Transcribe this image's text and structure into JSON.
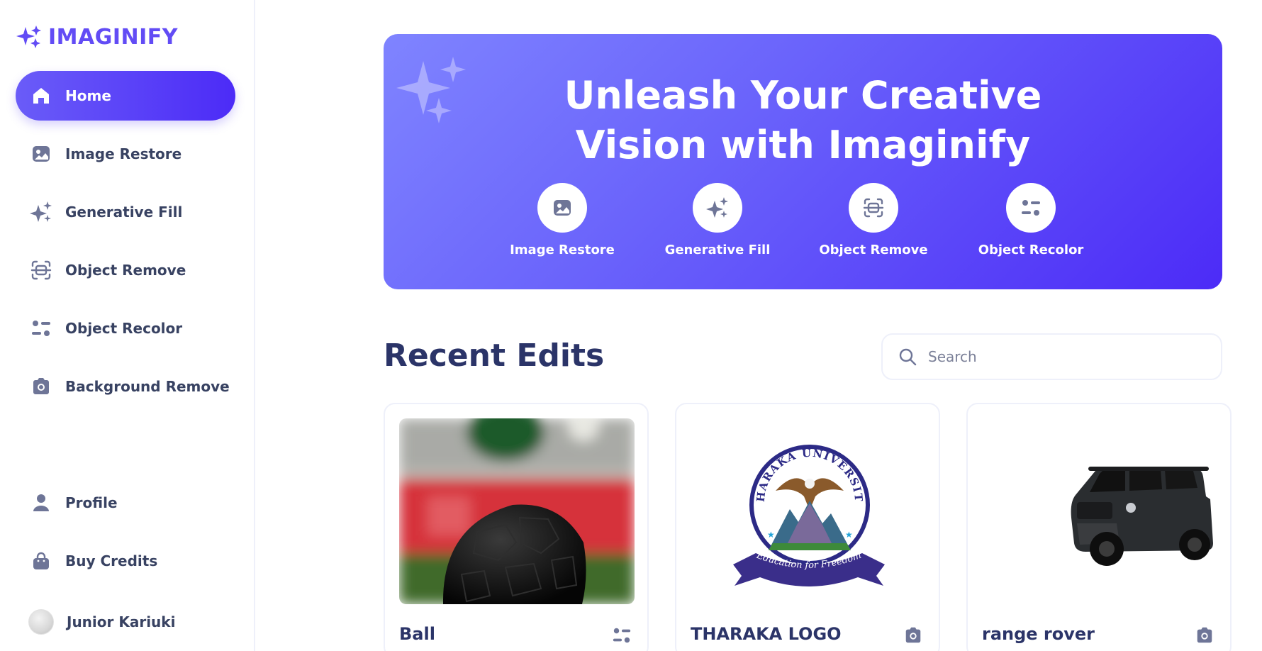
{
  "brand": {
    "name": "IMAGINIFY",
    "accent": "#624cf5"
  },
  "sidebar": {
    "items": [
      {
        "label": "Home",
        "icon": "home-icon",
        "active": true
      },
      {
        "label": "Image Restore",
        "icon": "image-icon"
      },
      {
        "label": "Generative Fill",
        "icon": "stars-icon"
      },
      {
        "label": "Object Remove",
        "icon": "scan-icon"
      },
      {
        "label": "Object Recolor",
        "icon": "filter-icon"
      },
      {
        "label": "Background Remove",
        "icon": "camera-icon"
      }
    ],
    "bottom": [
      {
        "label": "Profile",
        "icon": "profile-icon"
      },
      {
        "label": "Buy Credits",
        "icon": "bag-icon"
      }
    ],
    "user": {
      "name": "Junior Kariuki"
    }
  },
  "hero": {
    "title_line1": "Unleash Your Creative",
    "title_line2": "Vision with Imaginify",
    "tools": [
      {
        "label": "Image Restore",
        "icon": "image-icon"
      },
      {
        "label": "Generative Fill",
        "icon": "stars-icon"
      },
      {
        "label": "Object Remove",
        "icon": "scan-icon"
      },
      {
        "label": "Object Recolor",
        "icon": "filter-icon"
      }
    ]
  },
  "recent": {
    "title": "Recent Edits",
    "search": {
      "placeholder": "Search"
    },
    "cards": [
      {
        "title": "Ball",
        "type_icon": "filter-icon"
      },
      {
        "title": "THARAKA LOGO",
        "type_icon": "camera-icon"
      },
      {
        "title": "range rover",
        "type_icon": "camera-icon"
      }
    ]
  },
  "logo_text": {
    "university": "THARAKA UNIVERSITY",
    "motto": "Education for Freedom"
  }
}
